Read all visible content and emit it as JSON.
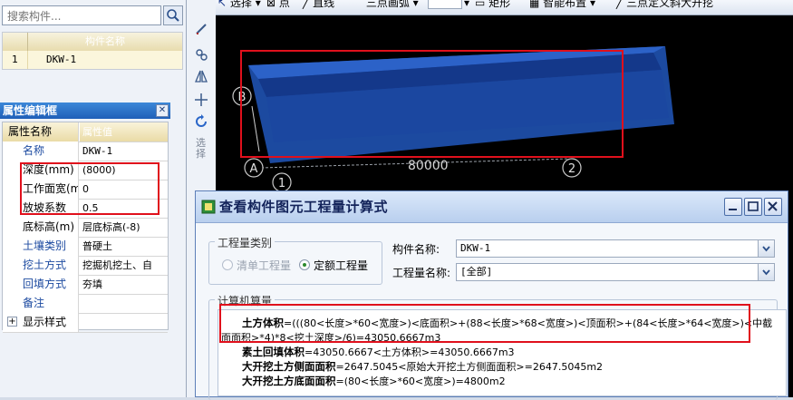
{
  "search": {
    "placeholder": "搜索构件..."
  },
  "component_table": {
    "header": "构件名称",
    "rows": [
      {
        "index": "1",
        "name": "DKW-1"
      }
    ]
  },
  "properties": {
    "title": "属性编辑框",
    "col_name": "属性名称",
    "col_value": "属性值",
    "rows": [
      {
        "index": "1",
        "name": "名称",
        "value": "DKW-1",
        "blue": true
      },
      {
        "index": "2",
        "name": "深度(mm)",
        "value": "(8000)",
        "blue": false
      },
      {
        "index": "3",
        "name": "工作面宽(m",
        "value": "0",
        "blue": false
      },
      {
        "index": "4",
        "name": "放坡系数",
        "value": "0.5",
        "blue": false
      },
      {
        "index": "5",
        "name": "底标高(m)",
        "value": "层底标高(-8)",
        "blue": false
      },
      {
        "index": "6",
        "name": "土壤类别",
        "value": "普硬土",
        "blue": true
      },
      {
        "index": "7",
        "name": "挖土方式",
        "value": "挖掘机挖土、自",
        "blue": true
      },
      {
        "index": "8",
        "name": "回填方式",
        "value": "夯填",
        "blue": true
      },
      {
        "index": "9",
        "name": "备注",
        "value": "",
        "blue": false
      },
      {
        "index": "10",
        "name": "显示样式",
        "value": "",
        "blue": false
      }
    ]
  },
  "vertical_tool": {
    "label": "选择"
  },
  "top_toolbar": {
    "select": "选择",
    "point": "点",
    "line": "直线",
    "arc": "三点画弧",
    "rect": "矩形",
    "smart": "智能布置",
    "custom": "三点定义斜大开挖"
  },
  "drawing": {
    "axis_b": "B",
    "axis_a": "A",
    "axis_1": "1",
    "axis_2": "2",
    "dimension": "80000"
  },
  "dialog": {
    "title": "查看构件图元工程量计算式",
    "category_legend": "工程量类别",
    "radio_bill": "清单工程量",
    "radio_quota": "定额工程量",
    "component_label": "构件名称:",
    "component_value": "DKW-1",
    "qty_label": "工程量名称:",
    "qty_value": "[全部]",
    "calc_legend": "计算机算量",
    "lines": [
      {
        "term": "土方体积",
        "formula": "=(((80<长度>*60<宽度>)<底面积>+(88<长度>*68<宽度>)<顶面积>+(84<长度>*64<宽度>)<中截"
      },
      {
        "term": "",
        "formula": "面面积>*4)*8<挖土深度>/6)=43050.6667m3"
      },
      {
        "term": "素土回填体积",
        "formula": "=43050.6667<土方体积>=43050.6667m3"
      },
      {
        "term": "大开挖土方侧面面积",
        "formula": "=2647.5045<原始大开挖土方侧面面积>=2647.5045m2"
      },
      {
        "term": "大开挖土方底面面积",
        "formula": "=(80<长度>*60<宽度>)=4800m2"
      }
    ]
  },
  "colors": {
    "highlight": "#e0101c",
    "pit_fill": "#1f4fa8",
    "canvas_bg": "#000000",
    "title_blue": "#1f5fb8"
  }
}
